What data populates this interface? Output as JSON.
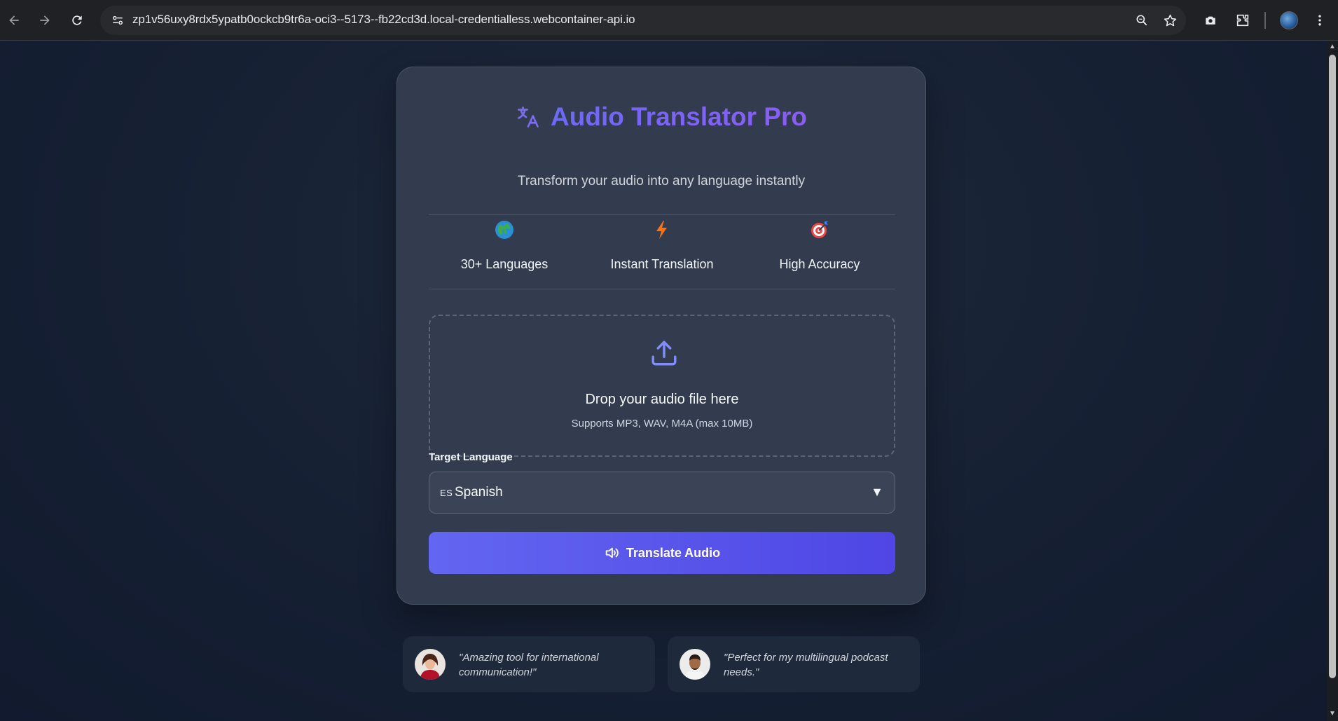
{
  "browser": {
    "url": "zp1v56uxy8rdx5ypatb0ockcb9tr6a-oci3--5173--fb22cd3d.local-credentialless.webcontainer-api.io"
  },
  "app": {
    "title": "Audio Translator Pro",
    "subtitle": "Transform your audio into any language instantly"
  },
  "features": [
    {
      "label": "30+ Languages",
      "icon": "globe-icon"
    },
    {
      "label": "Instant Translation",
      "icon": "lightning-icon"
    },
    {
      "label": "High Accuracy",
      "icon": "target-icon"
    }
  ],
  "upload": {
    "title": "Drop your audio file here",
    "supported": "Supports MP3, WAV, M4A (max 10MB)"
  },
  "language": {
    "label": "Target Language",
    "selected_code": "ES",
    "selected_name": "Spanish"
  },
  "translate_button": {
    "label": "Translate Audio"
  },
  "testimonials": [
    {
      "quote": "\"Amazing tool for international communication!\""
    },
    {
      "quote": "\"Perfect for my multilingual podcast needs.\""
    }
  ],
  "colors": {
    "accent": "#6366f1",
    "title": "#7b68ee",
    "background": "#1e293b"
  }
}
